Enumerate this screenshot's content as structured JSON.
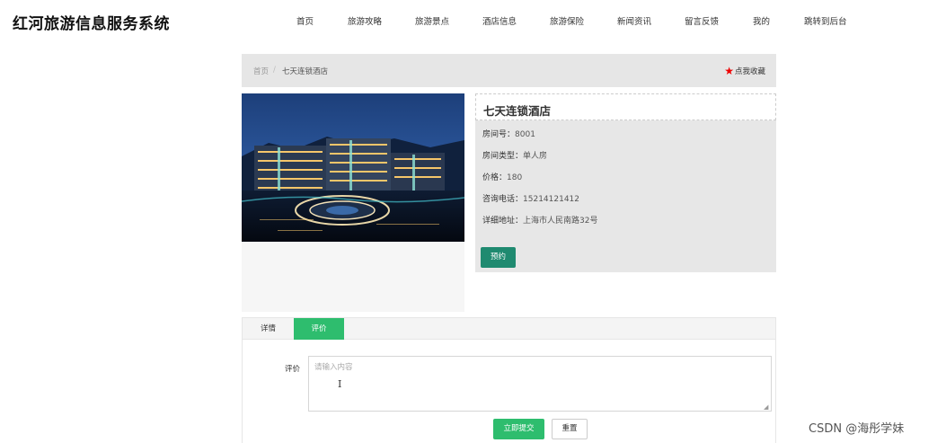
{
  "header": {
    "site_title": "红河旅游信息服务系统",
    "nav": [
      "首页",
      "旅游攻略",
      "旅游景点",
      "酒店信息",
      "旅游保险",
      "新闻资讯",
      "留言反馈",
      "我的",
      "跳转到后台"
    ]
  },
  "breadcrumb": {
    "home": "首页",
    "separator": "/",
    "current": "七天连锁酒店",
    "favorite_label": "点我收藏",
    "favorite_icon": "star-icon"
  },
  "hotel": {
    "name": "七天连锁酒店",
    "fields": [
      {
        "label": "房间号：",
        "value": "8001"
      },
      {
        "label": "房间类型：",
        "value": "单人房"
      },
      {
        "label": "价格：",
        "value": "180"
      },
      {
        "label": "咨询电话：",
        "value": "15214121412"
      },
      {
        "label": "详细地址：",
        "value": "上海市人民南路32号"
      }
    ],
    "book_label": "预约"
  },
  "tabs": [
    {
      "label": "详情",
      "active": false
    },
    {
      "label": "评价",
      "active": true
    }
  ],
  "review": {
    "label": "评价",
    "placeholder": "请输入内容",
    "value": "",
    "submit_label": "立即提交",
    "reset_label": "重置"
  },
  "watermark": "CSDN @海彤学妹",
  "colors": {
    "accent_green": "#2ebd6e",
    "book_green": "#1f8a70",
    "star_red": "#e00000"
  }
}
